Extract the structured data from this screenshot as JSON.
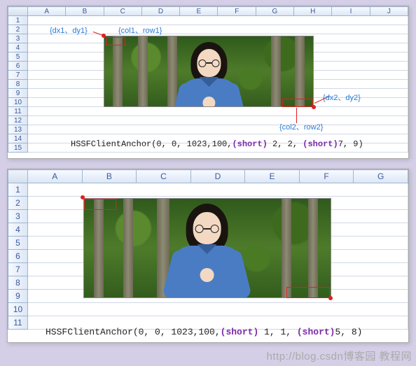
{
  "panel1": {
    "cols": [
      "A",
      "B",
      "C",
      "D",
      "E",
      "F",
      "G",
      "H",
      "I",
      "J"
    ],
    "rows": [
      "1",
      "2",
      "3",
      "4",
      "5",
      "6",
      "7",
      "8",
      "9",
      "10",
      "11",
      "12",
      "13",
      "14",
      "15"
    ],
    "annot": {
      "dx1dy1": "{dx1、dy1}",
      "col1row1": "{col1、row1}",
      "dx2dy2": "{dx2、dy2}",
      "col2row2": "{col2、row2}"
    },
    "code": {
      "fn": "HSSFClientAnchor(0, 0, 1023,100,",
      "kw": "(short)",
      "mid": " 2, 2, ",
      "end": "7, 9)"
    }
  },
  "panel2": {
    "cols": [
      "A",
      "B",
      "C",
      "D",
      "E",
      "F",
      "G"
    ],
    "rows": [
      "1",
      "2",
      "3",
      "4",
      "5",
      "6",
      "7",
      "8",
      "9",
      "10",
      "11"
    ],
    "code": {
      "fn": "HSSFClientAnchor(0, 0, 1023,100,",
      "kw": "(short)",
      "mid": " 1, 1, ",
      "end": "5, 8)"
    }
  },
  "watermark": "http://blog.csdn博客园 教程网"
}
